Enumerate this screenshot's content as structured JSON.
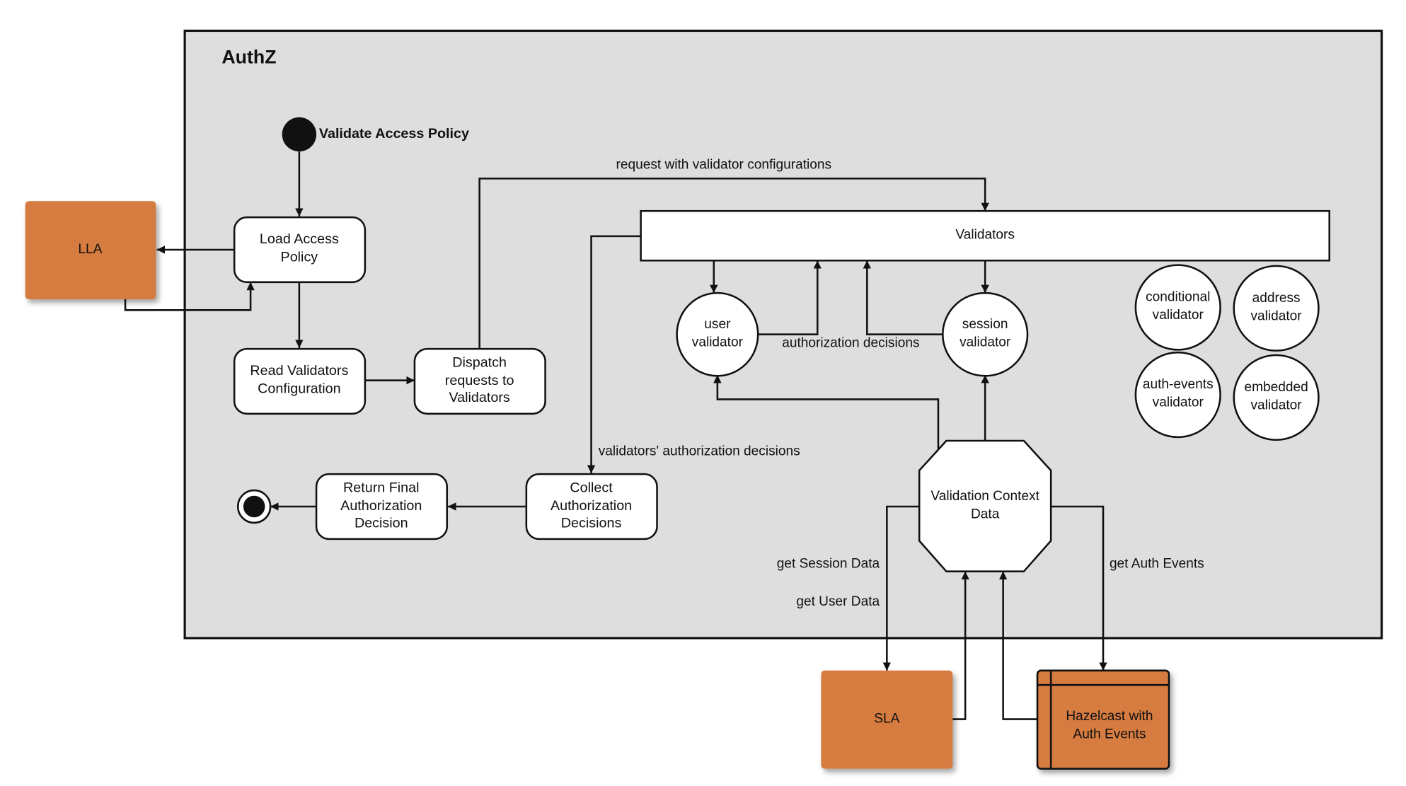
{
  "diagram": {
    "frame_title": "AuthZ",
    "start_label": "Validate Access Policy",
    "colors": {
      "frame_bg": "#dedede",
      "external": "#d67b40",
      "node": "#ffffff",
      "line": "#111111"
    },
    "external": {
      "lla": "LLA",
      "sla": "SLA",
      "hazelcast": [
        "Hazelcast with",
        "Auth Events"
      ]
    },
    "activities": {
      "load_policy": [
        "Load Access",
        "Policy"
      ],
      "read_config": [
        "Read Validators",
        "Configuration"
      ],
      "dispatch": [
        "Dispatch",
        "requests to",
        "Validators"
      ],
      "collect": [
        "Collect",
        "Authorization",
        "Decisions"
      ],
      "return_final": [
        "Return Final",
        "Authorization",
        "Decision"
      ]
    },
    "validators_box": "Validators",
    "validators": {
      "user": [
        "user",
        "validator"
      ],
      "session": [
        "session",
        "validator"
      ],
      "conditional": [
        "conditional",
        "validator"
      ],
      "address": [
        "address",
        "validator"
      ],
      "auth_events": [
        "auth-events",
        "validator"
      ],
      "embedded": [
        "embedded",
        "validator"
      ]
    },
    "context_data": [
      "Validation Context",
      "Data"
    ],
    "edge_labels": {
      "request_with_config": "request with validator configurations",
      "authorization_decisions": "authorization decisions",
      "validators_decisions": "validators' authorization decisions",
      "get_session_data": "get Session Data",
      "get_user_data": "get User Data",
      "get_auth_events": "get Auth Events"
    }
  }
}
